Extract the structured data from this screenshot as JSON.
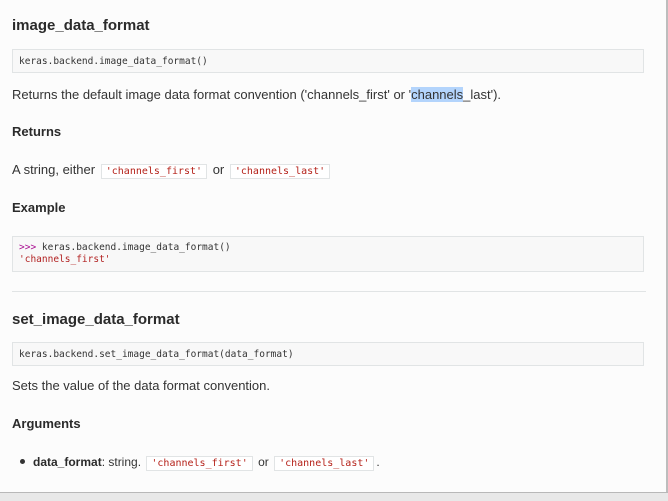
{
  "section1": {
    "title": "image_data_format",
    "signature": "keras.backend.image_data_format()",
    "description_before": "Returns the default image data format convention ('channels_first' or '",
    "description_highlight": "channels",
    "description_after": "_last').",
    "returns_heading": "Returns",
    "returns_prefix": "A string, either",
    "returns_value1": "'channels_first'",
    "returns_or": "or",
    "returns_value2": "'channels_last'",
    "example_heading": "Example",
    "example_prompt": ">>>",
    "example_code": " keras.backend.image_data_format()",
    "example_output": "'channels_first'"
  },
  "section2": {
    "title": "set_image_data_format",
    "signature": "keras.backend.set_image_data_format(data_format)",
    "description": "Sets the value of the data format convention.",
    "arguments_heading": "Arguments",
    "arg_name": "data_format",
    "arg_type": ": string.",
    "arg_value1": "'channels_first'",
    "arg_or": "or",
    "arg_value2": "'channels_last'",
    "arg_end": "."
  }
}
